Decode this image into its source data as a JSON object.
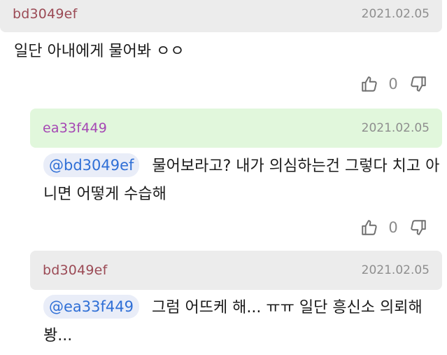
{
  "comments": [
    {
      "author": "bd3049ef",
      "date": "2021.02.05",
      "text": "일단 아내에게 물어봐 ㅇㅇ",
      "likes": "0"
    },
    {
      "author": "ea33f449",
      "date": "2021.02.05",
      "mention": "@bd3049ef",
      "text": "물어보라고? 내가 의심하는건 그렇다 치고 아니면 어떻게 수습해",
      "likes": "0"
    },
    {
      "author": "bd3049ef",
      "date": "2021.02.05",
      "mention": "@ea33f449",
      "text": "그럼 어뜨케 해... ㅠㅠ 일단 흥신소 의뢰해봥..."
    }
  ],
  "icons": {
    "like": "thumbs-up-icon",
    "dislike": "thumbs-down-icon"
  },
  "colors": {
    "author_brown": "#9b4a55",
    "author_purple": "#a547b4",
    "mention_blue": "#2f6fd6",
    "reply_header_green": "#e1f7dc",
    "header_gray": "#ececec"
  }
}
